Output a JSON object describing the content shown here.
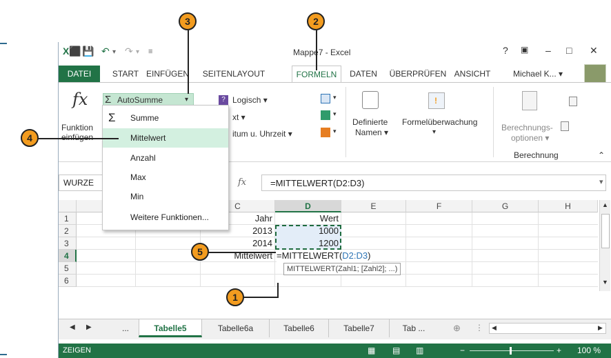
{
  "app": {
    "document_title": "Mappe7 - Excel",
    "user": "Michael K...",
    "help": "?"
  },
  "tabs": [
    "DATEI",
    "START",
    "EINFÜGEN",
    "SEITENLAYOUT",
    "FORMELN",
    "DATEN",
    "ÜBERPRÜFEN",
    "ANSICHT"
  ],
  "ribbon": {
    "funktion_label_1": "Funktion",
    "funktion_label_2": "einfügen",
    "autosumme": "AutoSumme",
    "logisch": "Logisch",
    "text": "xt",
    "datum": "itum u. Uhrzeit",
    "definierte_1": "Definierte",
    "definierte_2": "Namen",
    "formelueberwachung": "Formelüberwachung",
    "berechnungs_1": "Berechnungs-",
    "berechnungs_2": "optionen",
    "berechnung_group": "Berechnung"
  },
  "dropdown": {
    "items": [
      "Summe",
      "Mittelwert",
      "Anzahl",
      "Max",
      "Min",
      "Weitere Funktionen..."
    ],
    "highlighted": "Mittelwert"
  },
  "formula_bar": {
    "namebox": "WURZE",
    "fx": "fx",
    "formula": "=MITTELWERT(D2:D3)"
  },
  "grid": {
    "columns": [
      "C",
      "D",
      "E",
      "F",
      "G",
      "H"
    ],
    "rows": [
      "1",
      "2",
      "3",
      "4",
      "5",
      "6"
    ],
    "c1": "Jahr",
    "d1": "Wert",
    "c2": "2013",
    "d2": "1000",
    "c3": "2014",
    "d3": "1200",
    "c4": "Mittelwert",
    "d4_func": "=MITTELWERT(",
    "d4_ref": "D2:D3",
    "d4_close": ")",
    "tooltip_func": "MITTELWERT(",
    "tooltip_args": "Zahl1; [Zahl2]; ...)"
  },
  "sheets": [
    "...",
    "Tabelle5",
    "Tabelle6a",
    "Tabelle6",
    "Tabelle7",
    "Tab ..."
  ],
  "active_sheet": "Tabelle5",
  "status": {
    "mode": "ZEIGEN",
    "zoom": "100 %"
  },
  "callouts": [
    "1",
    "2",
    "3",
    "4",
    "5"
  ],
  "colors": {
    "accent": "#217346",
    "callout": "#f39c1f",
    "highlight": "#d3f0e0",
    "reference": "#2e75b6"
  }
}
